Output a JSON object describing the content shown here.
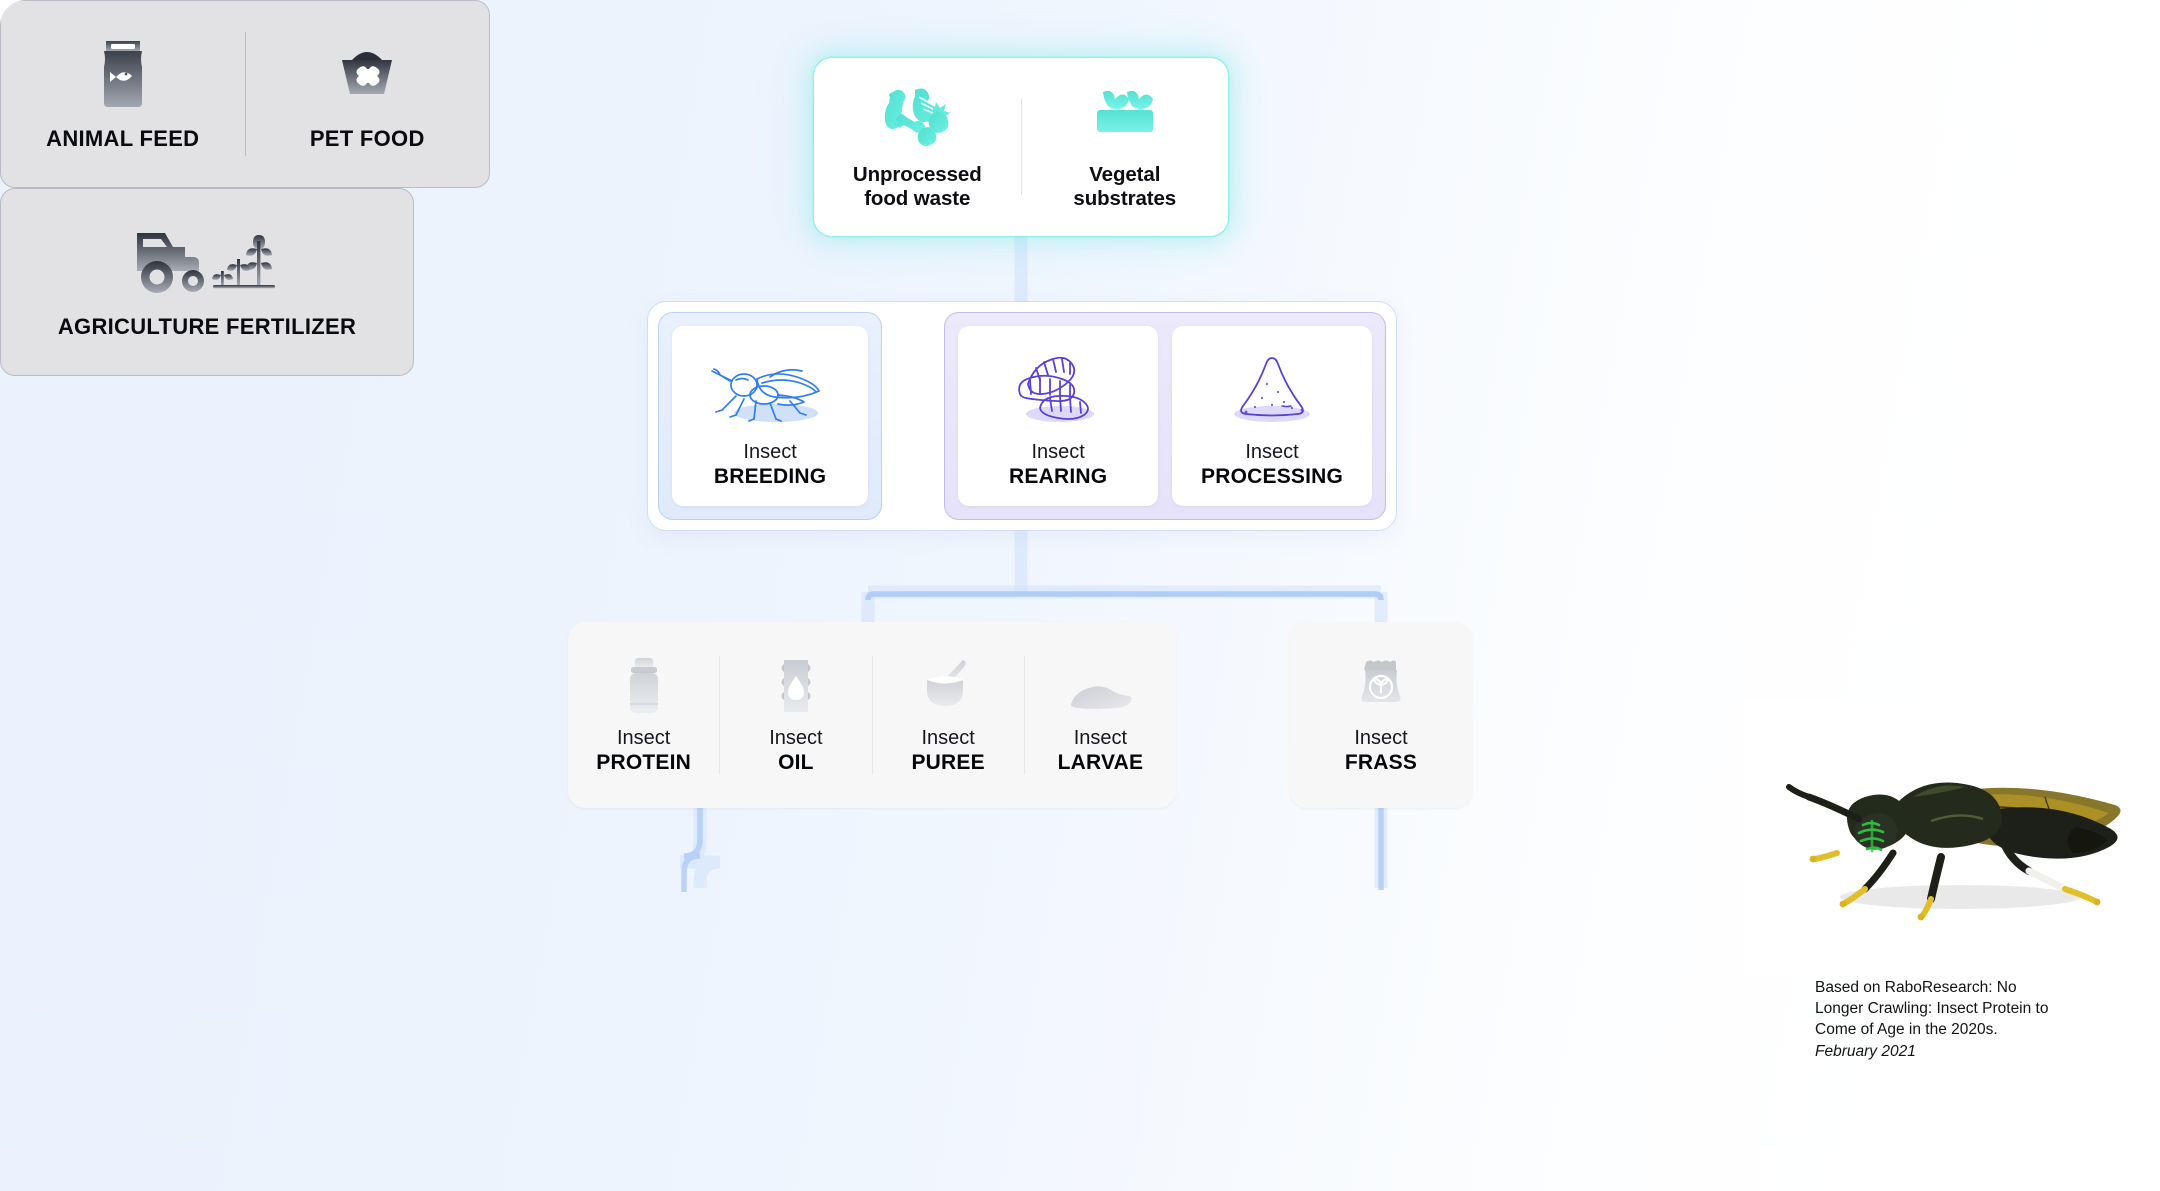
{
  "theme": {
    "background_left": "#eaf2fd",
    "background_right": "#ffffff",
    "accent_teal": "#5fe3d6",
    "accent_blue": "#3b82f6",
    "accent_purple": "#5b3fd6",
    "connector_blue": "#a9c4f2",
    "product_card_bg": "#f7f7f8",
    "application_card_bg": "#e2e2e4"
  },
  "inputs": {
    "items": [
      {
        "icon": "fish-bones-food-waste-icon",
        "line1": "Unprocessed",
        "line2": "food waste"
      },
      {
        "icon": "vegetal-substrate-sprouts-icon",
        "line1": "Vegetal",
        "line2": "substrates"
      }
    ]
  },
  "stages": {
    "breeding_group": {
      "border_color": "#b9d2f2",
      "items": [
        {
          "icon": "black-soldier-fly-icon",
          "light": "Insect",
          "bold": "BREEDING"
        }
      ]
    },
    "rearing_processing_group": {
      "border_color": "#c5b9ee",
      "items": [
        {
          "icon": "larvae-icon",
          "light": "Insect",
          "bold": "REARING"
        },
        {
          "icon": "powder-pile-icon",
          "light": "Insect",
          "bold": "PROCESSING"
        }
      ]
    }
  },
  "products": {
    "main": [
      {
        "icon": "protein-jar-icon",
        "light": "Insect",
        "bold": "PROTEIN"
      },
      {
        "icon": "oil-barrel-icon",
        "light": "Insect",
        "bold": "OIL"
      },
      {
        "icon": "puree-bowl-icon",
        "light": "Insect",
        "bold": "PUREE"
      },
      {
        "icon": "larvae-pile-icon",
        "light": "Insect",
        "bold": "LARVAE"
      }
    ],
    "side": [
      {
        "icon": "frass-bag-icon",
        "light": "Insect",
        "bold": "FRASS"
      }
    ]
  },
  "applications": {
    "left": [
      {
        "icon": "feed-bag-fish-icon",
        "label": "ANIMAL FEED"
      },
      {
        "icon": "pet-bowl-bone-icon",
        "label": "PET FOOD"
      }
    ],
    "right": [
      {
        "icon": "tractor-plants-icon",
        "label": "AGRICULTURE FERTILIZER"
      }
    ]
  },
  "source": {
    "photo_alt": "black-soldier-fly-photo",
    "caption": "Based on RaboResearch: No Longer Crawling: Insect Protein to Come of Age in the 2020s.",
    "date": "February 2021"
  }
}
